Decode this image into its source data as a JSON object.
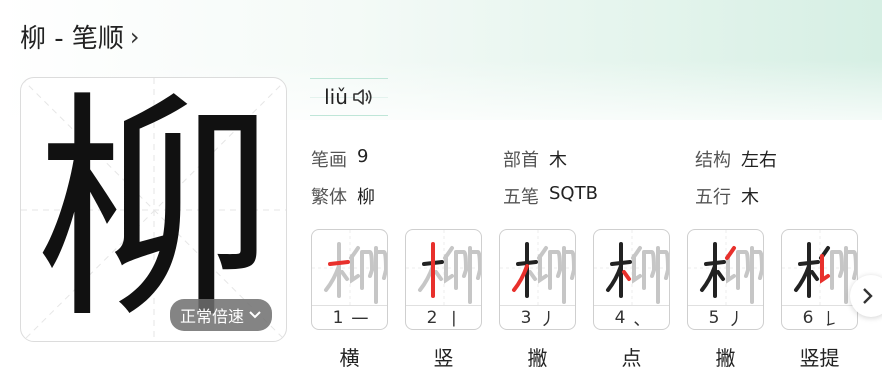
{
  "title": {
    "text": "柳 - 笔顺",
    "chevron": "›"
  },
  "character": {
    "glyph": "柳",
    "speed_label": "正常倍速",
    "speed_icon": "chevron-down"
  },
  "pinyin": {
    "text": "liǔ",
    "icon": "speaker-icon"
  },
  "info": {
    "strokes_key": "笔画",
    "strokes_val": "9",
    "radical_key": "部首",
    "radical_val": "木",
    "structure_key": "结构",
    "structure_val": "左右",
    "traditional_key": "繁体",
    "traditional_val": "柳",
    "wubi_key": "五笔",
    "wubi_val": "SQTB",
    "element_key": "五行",
    "element_val": "木"
  },
  "strokes": [
    {
      "num": "1",
      "glyph": "一",
      "name": "横"
    },
    {
      "num": "2",
      "glyph": "丨",
      "name": "竖"
    },
    {
      "num": "3",
      "glyph": "丿",
      "name": "撇"
    },
    {
      "num": "4",
      "glyph": "、",
      "name": "点"
    },
    {
      "num": "5",
      "glyph": "丿",
      "name": "撇"
    },
    {
      "num": "6",
      "glyph": "𠄌",
      "name": "竖提"
    }
  ],
  "colors": {
    "highlight": "#e8302c",
    "done": "#222222",
    "pending": "#c6c6c6",
    "accent_line": "#bfe6d8"
  }
}
